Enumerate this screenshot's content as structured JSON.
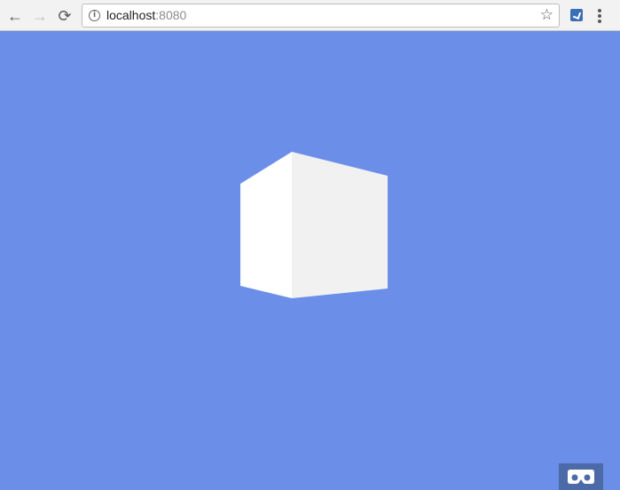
{
  "browser": {
    "back_label": "←",
    "forward_label": "→",
    "reload_label": "⟳",
    "url_host": "localhost",
    "url_port": ":8080",
    "info_icon_glyph": "i",
    "bookmark_glyph": "☆",
    "icons": {
      "back": "arrow-left-icon",
      "forward": "arrow-right-icon",
      "reload": "reload-icon",
      "info": "info-icon",
      "bookmark": "star-icon",
      "extension": "extension-icon",
      "menu": "kebab-menu-icon"
    }
  },
  "scene": {
    "background_color": "#6b8fe8",
    "cube": {
      "face_left_color": "#ffffff",
      "face_right_color": "#f1f1f1"
    },
    "vr_button": {
      "icon": "vr-goggles-icon",
      "background_color": "#4c6aa8"
    }
  }
}
